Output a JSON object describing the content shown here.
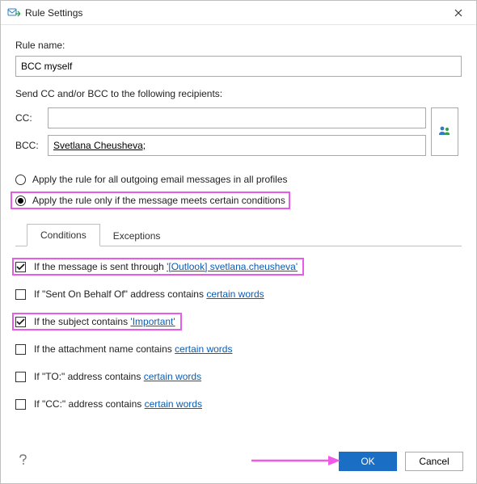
{
  "titlebar": {
    "title": "Rule Settings"
  },
  "rule_name": {
    "label": "Rule name:",
    "value": "BCC myself"
  },
  "recipients": {
    "heading": "Send CC and/or BCC to the following recipients:",
    "cc_label": "CC:",
    "bcc_label": "BCC:",
    "cc_value": "",
    "bcc_value": "Svetlana Cheusheva;"
  },
  "apply_scope": {
    "all": "Apply the rule for all outgoing email messages in all profiles",
    "conditional": "Apply the rule only if the message meets certain conditions",
    "selected": "conditional"
  },
  "tabs": {
    "conditions": "Conditions",
    "exceptions": "Exceptions"
  },
  "conditions": [
    {
      "checked": true,
      "prefix": "If the message is sent through ",
      "link": "'[Outlook] svetlana.cheusheva'",
      "highlight": true
    },
    {
      "checked": false,
      "prefix": "If \"Sent On Behalf Of\" address contains ",
      "link": "certain words",
      "highlight": false
    },
    {
      "checked": true,
      "prefix": "If the subject contains ",
      "link": "'Important'",
      "highlight": true
    },
    {
      "checked": false,
      "prefix": "If the attachment name contains ",
      "link": "certain words",
      "highlight": false
    },
    {
      "checked": false,
      "prefix": "If \"TO:\" address contains ",
      "link": "certain words",
      "highlight": false
    },
    {
      "checked": false,
      "prefix": "If \"CC:\" address contains ",
      "link": "certain words",
      "highlight": false
    }
  ],
  "footer": {
    "ok": "OK",
    "cancel": "Cancel"
  }
}
